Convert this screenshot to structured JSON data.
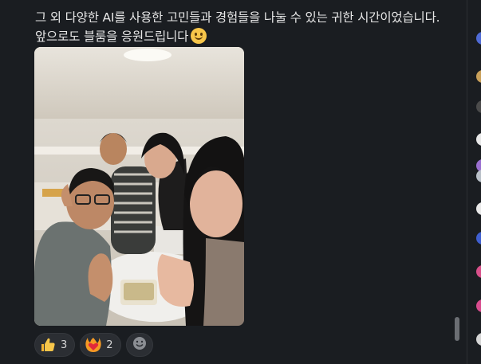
{
  "message": {
    "line1": "그 외 다양한 AI를 사용한 고민들과 경험들을 나눌 수 있는 귀한 시간이었습니다.",
    "line2": "앞으로도 블룸을 응원드립니다",
    "emoji": "slightly-smiling-face-icon"
  },
  "reactions": [
    {
      "icon": "thumbs-up-icon",
      "count": "3"
    },
    {
      "icon": "heart-on-fire-icon",
      "count": "2"
    }
  ],
  "add_reaction_icon": "add-reaction-icon",
  "colors": {
    "background": "#1a1d21",
    "reaction_bg": "#2b2e33",
    "text": "#e6e6e6"
  },
  "sidebar_avatar_colors": [
    "#4f6bd6",
    "#c9a05a",
    "#4b4b4b",
    "#e8e8e8",
    "#9a6fd0",
    "#b9c0c8",
    "#e9e9e9",
    "#3f5fd0",
    "#d8508a",
    "#d84c8e",
    "#d6d6d6"
  ]
}
